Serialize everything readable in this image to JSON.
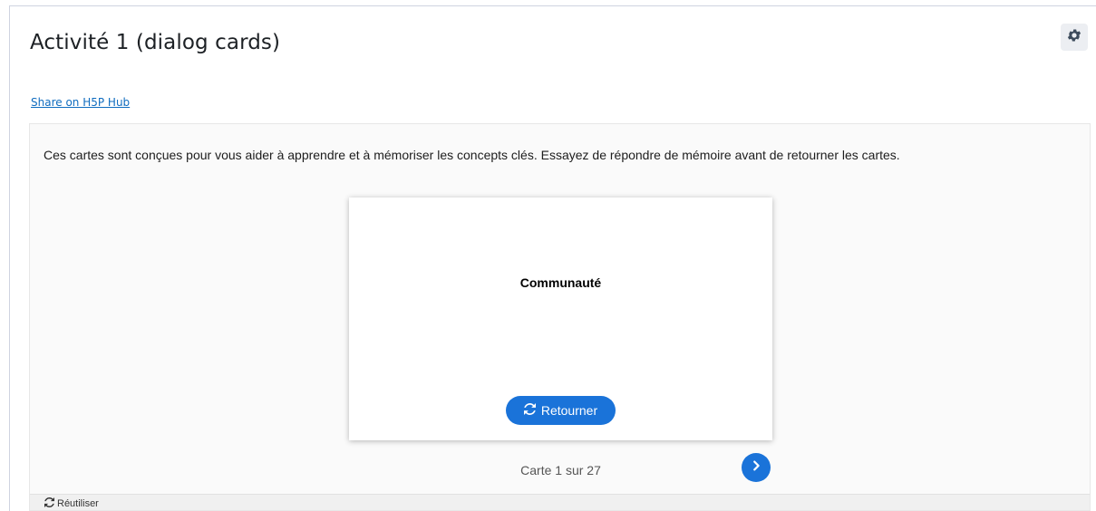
{
  "page": {
    "title": "Activité 1 (dialog cards)",
    "share_link": "Share on H5P Hub"
  },
  "h5p": {
    "description": "Ces cartes sont conçues pour vous aider à apprendre et à mémoriser les concepts clés. Essayez de répondre de mémoire avant de retourner les cartes.",
    "card": {
      "text": "Communauté",
      "turn_label": "Retourner"
    },
    "progress": "Carte 1 sur 27",
    "footer": {
      "reuse_label": "Réutiliser"
    }
  },
  "icons": {
    "settings": "gear-icon",
    "turn": "refresh-icon",
    "next": "chevron-right-icon",
    "reuse": "refresh-icon"
  },
  "colors": {
    "accent": "#1a73d9",
    "link": "#0f6cbf",
    "title": "#1d2125"
  }
}
